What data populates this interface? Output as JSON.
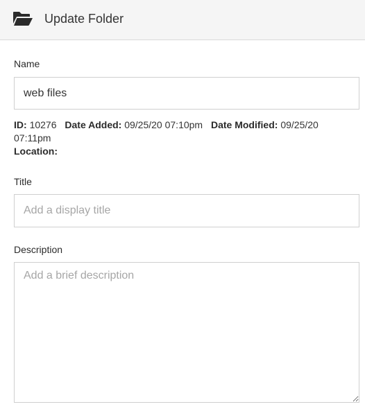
{
  "header": {
    "title": "Update Folder",
    "icon": "folder-open-icon"
  },
  "name": {
    "label": "Name",
    "value": "web files"
  },
  "meta": {
    "id_label": "ID:",
    "id_value": "10276",
    "date_added_label": "Date Added:",
    "date_added_value": "09/25/20 07:10pm",
    "date_modified_label": "Date Modified:",
    "date_modified_value": "09/25/20 07:11pm",
    "location_label": "Location:",
    "location_value": ""
  },
  "title_field": {
    "label": "Title",
    "placeholder": "Add a display title",
    "value": ""
  },
  "description_field": {
    "label": "Description",
    "placeholder": "Add a brief description",
    "value": ""
  }
}
